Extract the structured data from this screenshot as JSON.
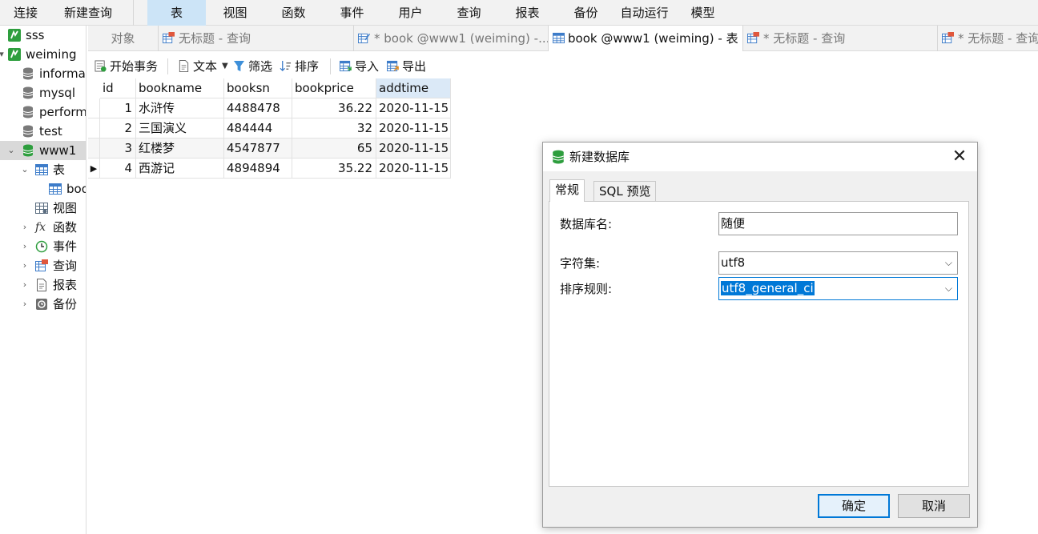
{
  "menubar": {
    "items": [
      "连接",
      "新建查询",
      "表",
      "视图",
      "函数",
      "事件",
      "用户",
      "查询",
      "报表",
      "备份",
      "自动运行",
      "模型"
    ],
    "active_index": 2
  },
  "sidebar": {
    "items": [
      {
        "label": "sss",
        "icon": "connection-icon",
        "arrow": ""
      },
      {
        "label": "weiming",
        "icon": "connection-icon",
        "arrow": "expanded"
      },
      {
        "label": "informat",
        "icon": "database-icon",
        "arrow": ""
      },
      {
        "label": "mysql",
        "icon": "database-icon",
        "arrow": ""
      },
      {
        "label": "perform",
        "icon": "database-icon",
        "arrow": ""
      },
      {
        "label": "test",
        "icon": "database-icon",
        "arrow": ""
      },
      {
        "label": "www1",
        "icon": "database-icon",
        "arrow": "expanded"
      },
      {
        "label": "表",
        "icon": "table-icon",
        "arrow": "expanded"
      },
      {
        "label": "boo",
        "icon": "table-icon",
        "arrow": ""
      },
      {
        "label": "视图",
        "icon": "view-icon",
        "arrow": ""
      },
      {
        "label": "函数",
        "icon": "function-icon",
        "arrow": "collapsed"
      },
      {
        "label": "事件",
        "icon": "event-icon",
        "arrow": "collapsed"
      },
      {
        "label": "查询",
        "icon": "query-icon",
        "arrow": "collapsed"
      },
      {
        "label": "报表",
        "icon": "report-icon",
        "arrow": "collapsed"
      },
      {
        "label": "备份",
        "icon": "backup-icon",
        "arrow": "collapsed"
      }
    ]
  },
  "tabs": [
    {
      "label": "对象",
      "icon": ""
    },
    {
      "label": "无标题 - 查询",
      "icon": "query-icon"
    },
    {
      "label": "* book @www1 (weiming) -...",
      "icon": "design-icon"
    },
    {
      "label": "book @www1 (weiming) - 表",
      "icon": "table-icon"
    },
    {
      "label": "* 无标题 - 查询",
      "icon": "query-icon"
    },
    {
      "label": "* 无标题 - 查询",
      "icon": "query-icon"
    }
  ],
  "toolbar": {
    "begin_transaction": "开始事务",
    "text": "文本",
    "filter": "筛选",
    "sort": "排序",
    "import": "导入",
    "export": "导出"
  },
  "grid": {
    "columns": [
      "id",
      "bookname",
      "booksn",
      "bookprice",
      "addtime"
    ],
    "rows": [
      [
        "1",
        "水浒传",
        "4488478",
        "36.22",
        "2020-11-15"
      ],
      [
        "2",
        "三国演义",
        "484444",
        "32",
        "2020-11-15"
      ],
      [
        "3",
        "红楼梦",
        "4547877",
        "65",
        "2020-11-15"
      ],
      [
        "4",
        "西游记",
        "4894894",
        "35.22",
        "2020-11-15"
      ]
    ]
  },
  "dialog": {
    "title": "新建数据库",
    "tabs": [
      "常规",
      "SQL 预览"
    ],
    "db_name_label": "数据库名:",
    "db_name_value": "随便",
    "charset_label": "字符集:",
    "charset_value": "utf8",
    "collation_label": "排序规则:",
    "collation_value": "utf8_general_ci",
    "ok": "确定",
    "cancel": "取消"
  },
  "colors": {
    "accent": "#0078d7",
    "menu_active": "#cce4f7",
    "db_green": "#2e9e3e"
  }
}
